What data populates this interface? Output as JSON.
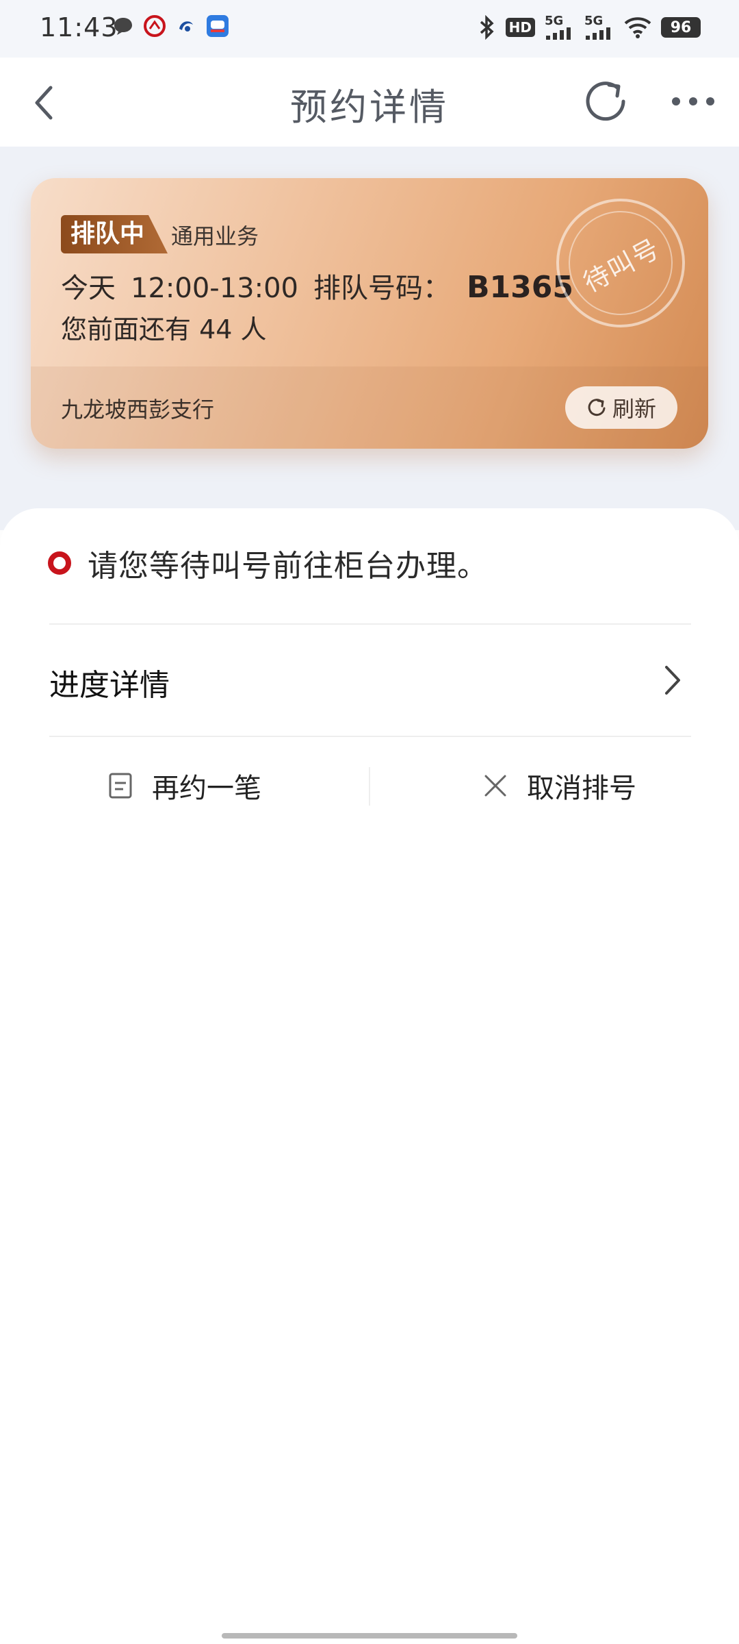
{
  "status_bar": {
    "time": "11:43",
    "hd_label": "HD",
    "signal_1": "5G",
    "signal_2": "5G",
    "battery": "96"
  },
  "header": {
    "title": "预约详情"
  },
  "queue_card": {
    "status_tag": "排队中",
    "business_type": "通用业务",
    "date_label": "今天",
    "time_range": "12:00-13:00",
    "queue_number_label": "排队号码：",
    "queue_number": "B1365",
    "ahead_text": "您前面还有 44 人",
    "stamp_text": "待叫号",
    "branch_name": "九龙坡西彭支行",
    "refresh_label": "刷新"
  },
  "notice": {
    "text": "请您等待叫号前往柜台办理。"
  },
  "progress": {
    "label": "进度详情"
  },
  "actions": {
    "rebook_label": "再约一笔",
    "cancel_label": "取消排号"
  },
  "colors": {
    "accent_red": "#c8141c",
    "tag_brown": "#8c4a1c",
    "card_gradient_start": "#f7ddc9",
    "card_gradient_end": "#d38a52",
    "page_grey": "#eef1f7"
  },
  "icons": {
    "back": "chevron-left-icon",
    "refresh": "refresh-icon",
    "more": "more-dots-icon",
    "chevron": "chevron-right-icon",
    "rebook": "document-icon",
    "cancel": "close-icon"
  }
}
